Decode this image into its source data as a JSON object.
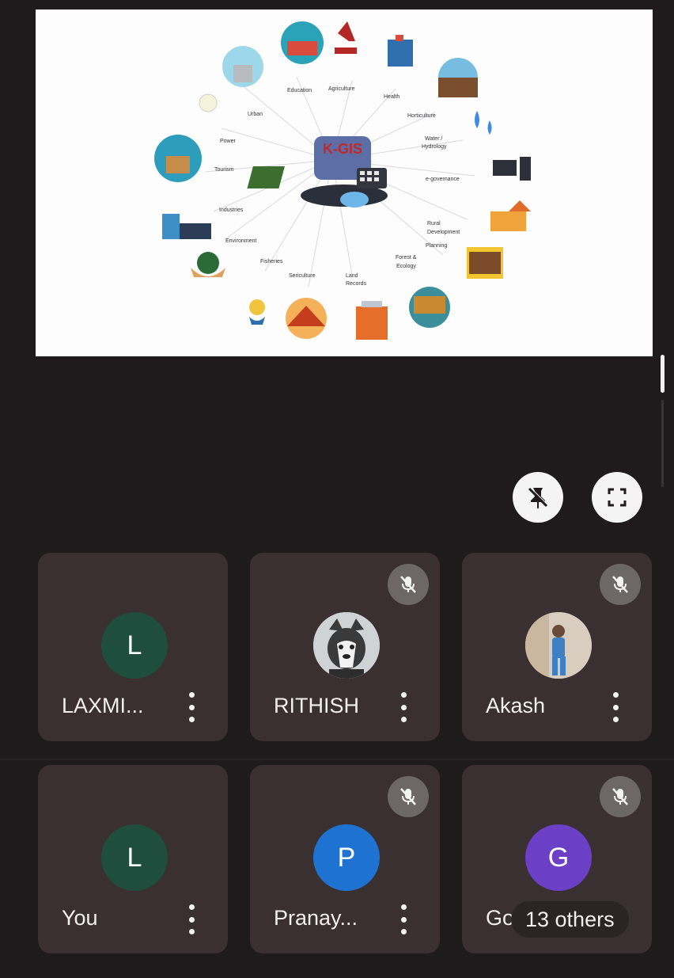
{
  "slide": {
    "title": "K-GIS",
    "sectors": [
      "Education",
      "Agriculture",
      "Health",
      "Horticulture",
      "Water / Hydrology",
      "e-governance",
      "Rural Development",
      "Planning",
      "Forest & Ecology",
      "Land Records",
      "Sericulture",
      "Fisheries",
      "Environment",
      "Industries",
      "Tourism",
      "Power",
      "Urban"
    ]
  },
  "controls": {
    "unpin_icon": "unpin-icon",
    "fullscreen_icon": "fullscreen-icon"
  },
  "participants": [
    {
      "name": "LAXMI...",
      "initial": "L",
      "avatar_color": "#1f4d3e",
      "muted": false,
      "photo": null
    },
    {
      "name": "RITHISH",
      "initial": "",
      "avatar_color": "#d9d9d9",
      "muted": true,
      "photo": "husky-photo"
    },
    {
      "name": "Akash",
      "initial": "",
      "avatar_color": "#c8c2b8",
      "muted": true,
      "photo": "person-photo"
    },
    {
      "name": "You",
      "initial": "L",
      "avatar_color": "#1f4d3e",
      "muted": false,
      "photo": null
    },
    {
      "name": "Pranay...",
      "initial": "P",
      "avatar_color": "#1e73d2",
      "muted": true,
      "photo": null
    },
    {
      "name": "Go",
      "initial": "G",
      "avatar_color": "#6b3fc6",
      "muted": true,
      "photo": null,
      "others_label": "13 others"
    }
  ]
}
